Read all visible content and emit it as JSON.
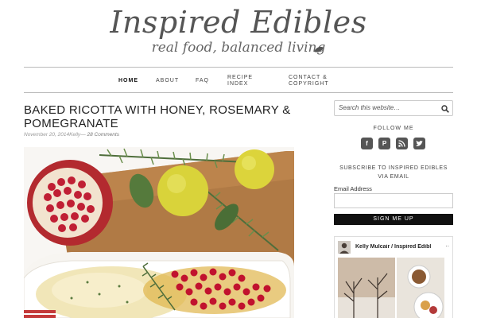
{
  "site": {
    "title": "Inspired Edibles",
    "tagline": "real food, balanced living"
  },
  "nav": {
    "home": "HOME",
    "about": "ABOUT",
    "faq": "FAQ",
    "recipe_index": "RECIPE INDEX",
    "contact": "CONTACT & COPYRIGHT"
  },
  "post": {
    "title": "BAKED RICOTTA WITH HONEY, ROSEMARY & POMEGRANATE",
    "date": "November 20, 2014",
    "author": "Kelly",
    "separator": "—",
    "comments": "28 Comments"
  },
  "sidebar": {
    "search_placeholder": "Search this website…",
    "follow_label": "FOLLOW ME",
    "subscribe_label": "SUBSCRIBE TO INSPIRED EDIBLES VIA EMAIL",
    "email_label": "Email Address",
    "signup_label": "SIGN ME UP",
    "fb_name": "Kelly Mulcair / Inspired Edibl",
    "fb_more": "..",
    "social_icons": [
      "facebook-icon",
      "pinterest-icon",
      "rss-icon",
      "twitter-icon"
    ]
  },
  "colors": {
    "accent": "#111111",
    "social_bg": "#555555",
    "text": "#333333"
  }
}
